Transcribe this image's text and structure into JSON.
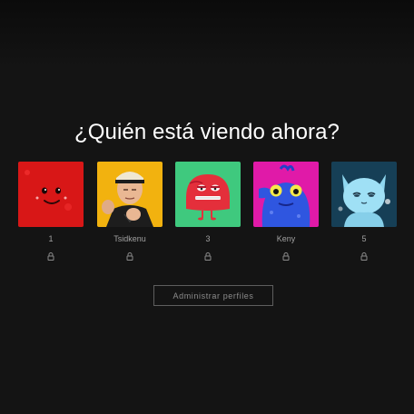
{
  "title": "¿Quién está viendo ahora?",
  "profiles": [
    {
      "name": "1",
      "avatar": "red-smiley-avatar",
      "color": "#e51c1c",
      "locked": true
    },
    {
      "name": "Tsidkenu",
      "avatar": "karate-man-avatar",
      "color": "#f2b20f",
      "locked": true
    },
    {
      "name": "3",
      "avatar": "red-monster-avatar",
      "color": "#3fc97e",
      "locked": true
    },
    {
      "name": "Keny",
      "avatar": "blue-creature-avatar",
      "color": "#e01aa8",
      "locked": true
    },
    {
      "name": "5",
      "avatar": "blue-cat-avatar",
      "color": "#1d4e66",
      "locked": true
    }
  ],
  "manage_button": "Administrar perfiles",
  "icons": {
    "lock": "lock-icon"
  }
}
